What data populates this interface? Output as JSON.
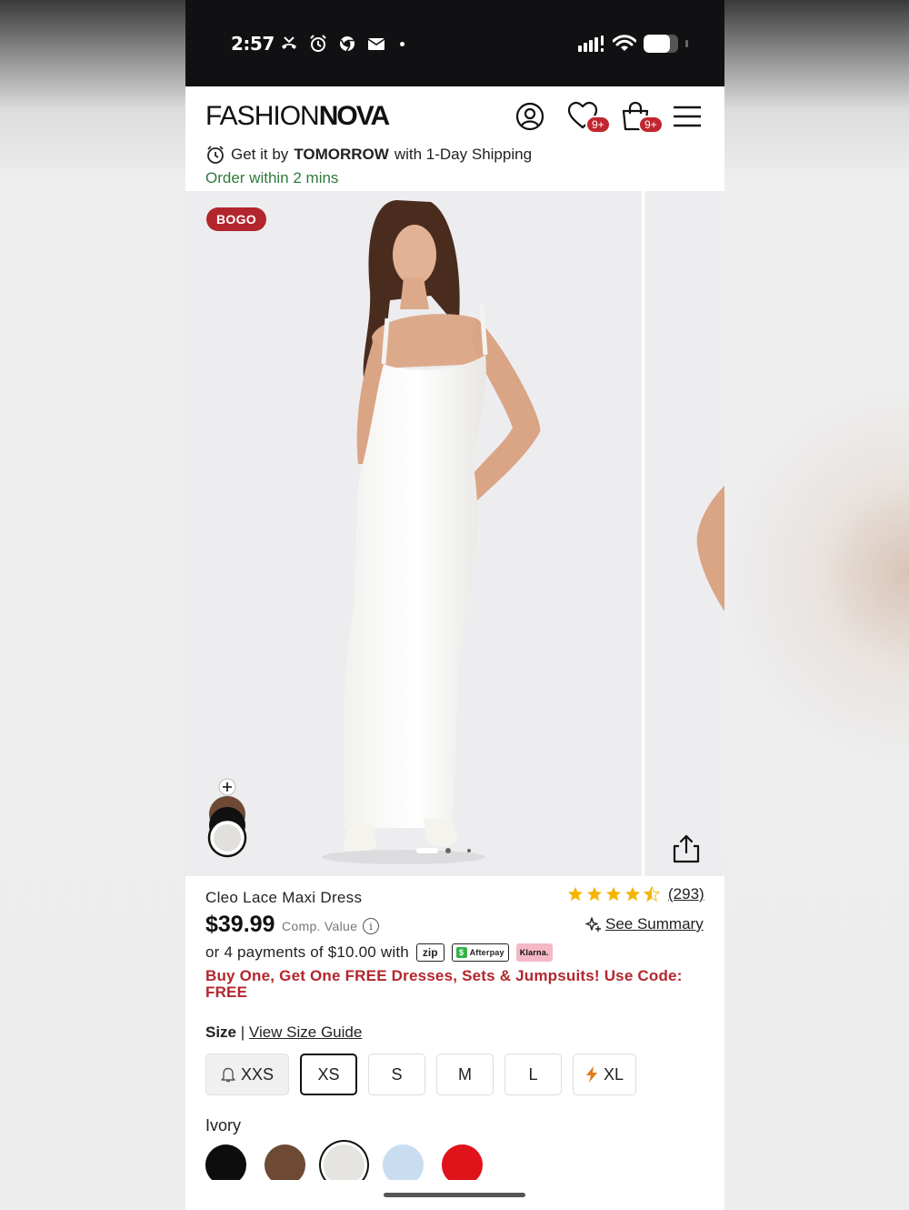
{
  "status_bar": {
    "time": "2:57",
    "icons_left": [
      "missed-call-icon",
      "alarm-icon",
      "chrome-icon",
      "mail-icon"
    ],
    "icons_right": [
      "cellular-signal-icon",
      "wifi-icon",
      "battery-icon"
    ],
    "battery_level": 0.75
  },
  "header": {
    "logo_light": "FASHION",
    "logo_bold": "NOVA",
    "wishlist_badge": "9+",
    "cart_badge": "9+"
  },
  "shipping": {
    "prefix": "Get it by",
    "day": "TOMORROW",
    "suffix": "with 1-Day Shipping",
    "order_within": "Order within 2 mins"
  },
  "gallery": {
    "badge": "BOGO",
    "active_slide": 1,
    "slide_count": 3
  },
  "product": {
    "name": "Cleo Lace Maxi Dress",
    "rating": 4.5,
    "review_count": "(293)",
    "price": "$39.99",
    "comp_value": "Comp. Value",
    "see_summary": "See Summary",
    "payments_text": "or 4 payments of $10.00 with",
    "pay_zip": "zip",
    "pay_afterpay": "Afterpay",
    "pay_klarna": "Klarna.",
    "promo": "Buy One, Get One FREE Dresses, Sets & Jumpsuits! Use Code: FREE"
  },
  "size": {
    "label": "Size",
    "guide": "View Size Guide",
    "options": [
      {
        "label": "XXS",
        "state": "notify"
      },
      {
        "label": "XS",
        "state": "selected"
      },
      {
        "label": "S",
        "state": "available"
      },
      {
        "label": "M",
        "state": "available"
      },
      {
        "label": "L",
        "state": "available"
      },
      {
        "label": "XL",
        "state": "low-stock"
      }
    ]
  },
  "color": {
    "label": "Ivory",
    "swatches": [
      {
        "name": "black",
        "hex": "#0d0d0d"
      },
      {
        "name": "brown",
        "hex": "#6e4a35"
      },
      {
        "name": "ivory",
        "hex": "#e6e4e1"
      },
      {
        "name": "light-blue",
        "hex": "#c8ddf0"
      },
      {
        "name": "red",
        "hex": "#e0121a"
      }
    ],
    "selected_index": 2
  },
  "colors": {
    "brand_red": "#b3262d",
    "green": "#2f7a3b",
    "star": "#f5b400"
  }
}
